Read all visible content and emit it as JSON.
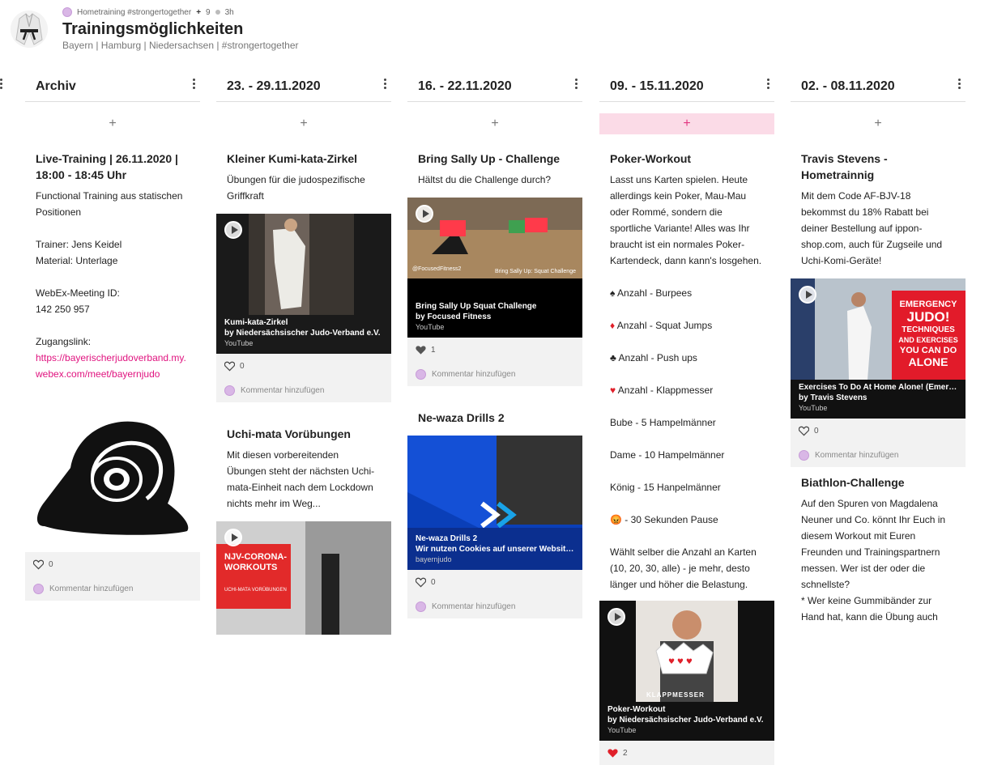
{
  "header": {
    "group": "Hometraining #strongertogether",
    "members": "9",
    "time": "3h",
    "title": "Trainingsmöglichkeiten",
    "subtitle": "Bayern | Hamburg | Niedersachsen | #strongertogether"
  },
  "common": {
    "comment_placeholder": "Kommentar hinzufügen",
    "add": "+"
  },
  "columns": [
    {
      "title": "Archiv",
      "posts": [
        {
          "title": "Live-Training | 26.11.2020 | 18:00 - 18:45 Uhr",
          "body": "Functional Training aus statischen Positionen\n\nTrainer: Jens Keidel\nMaterial: Unterlage\n\nWebEx-Meeting ID:\n142 250 957\n\nZugangslink:",
          "link": "https://bayerischerjudoverband.my.webex.com/meet/bayernjudo",
          "image": "webex-logo",
          "likes": "0"
        }
      ]
    },
    {
      "title": "23. - 29.11.2020",
      "posts": [
        {
          "title": "Kleiner Kumi-kata-Zirkel",
          "body": "Übungen für die judospezifische Griffkraft",
          "attachment": {
            "title": "Kumi-kata-Zirkel",
            "subtitle": "by Niedersächsischer Judo-Verband e.V.",
            "source": "YouTube"
          },
          "likes": "0"
        },
        {
          "title": "Uchi-mata Vorübungen",
          "body": "Mit diesen vorbereitenden Übungen steht der nächsten Uchi-mata-Einheit nach dem Lockdown nichts mehr im Weg...",
          "thumb_text": "NJV-CORONA-WORKOUTS",
          "thumb_sub": "UCHI-MATA VORÜBUNGEN"
        }
      ]
    },
    {
      "title": "16. - 22.11.2020",
      "posts": [
        {
          "title": "Bring Sally Up - Challenge",
          "body": "Hältst du die Challenge durch?",
          "thumb_tag": "@FocusedFitness2",
          "thumb_tag2": "Bring Sally Up: Squat Challenge",
          "attachment": {
            "title": "Bring Sally Up Squat Challenge",
            "subtitle": "by Focused Fitness",
            "source": "YouTube"
          },
          "likes": "1"
        },
        {
          "title": "Ne-waza Drills 2",
          "attachment": {
            "title": "Ne-waza Drills 2",
            "subtitle": "Wir nutzen Cookies auf unserer Website. ...",
            "source": "bayernjudo"
          },
          "likes": "0"
        }
      ]
    },
    {
      "title": "09. - 15.11.2020",
      "posts": [
        {
          "title": "Poker-Workout",
          "body": "Lasst uns Karten spielen. Heute allerdings kein Poker, Mau-Mau oder Rommé, sondern die sportliche Variante! Alles was Ihr braucht ist ein normales Poker-Kartendeck, dann kann's losgehen.",
          "list": [
            {
              "icon": "♠",
              "color": "#222",
              "text": " Anzahl - Burpees"
            },
            {
              "icon": "♦",
              "color": "#e0202a",
              "text": " Anzahl - Squat Jumps"
            },
            {
              "icon": "♣",
              "color": "#222",
              "text": " Anzahl - Push ups"
            },
            {
              "icon": "♥",
              "color": "#e0202a",
              "text": " Anzahl - Klappmesser"
            },
            {
              "icon": "",
              "color": "#222",
              "text": "Bube - 5 Hampelmänner"
            },
            {
              "icon": "",
              "color": "#222",
              "text": "Dame - 10 Hampelmänner"
            },
            {
              "icon": "",
              "color": "#222",
              "text": "König - 15 Hanpelmänner"
            },
            {
              "icon": "😡",
              "color": "#222",
              "text": " - 30 Sekunden Pause"
            }
          ],
          "body2": "Wählt selber die Anzahl an Karten (10, 20, 30, alle) - je mehr, desto länger und höher die Belastung.",
          "attachment": {
            "title": "Poker-Workout",
            "subtitle": "by Niedersächsischer Judo-Verband e.V.",
            "source": "YouTube"
          },
          "thumb_text": "KLAPPMESSER",
          "likes": "2"
        }
      ]
    },
    {
      "title": "02. - 08.11.2020",
      "posts": [
        {
          "title": "Travis Stevens - Hometrainnig",
          "body": "Mit dem Code AF-BJV-18 bekommst du 18% Rabatt bei deiner Bestellung auf ippon-shop.com, auch für Zugseile und Uchi-Komi-Geräte!",
          "thumb_lines": [
            "EMERGENCY",
            "JUDO!",
            "TECHNIQUES",
            "AND EXERCISES",
            "YOU CAN DO",
            "ALONE"
          ],
          "attachment": {
            "title": "Exercises To Do At Home Alone! (Emergency Judo)",
            "subtitle": "by Travis Stevens",
            "source": "YouTube"
          },
          "likes": "0"
        },
        {
          "title": "Biathlon-Challenge",
          "body": "Auf den Spuren von Magdalena Neuner und Co. könnt Ihr Euch in diesem Workout mit Euren Freunden und Trainingspartnern messen. Wer ist der oder die schnellste?\n* Wer keine Gummibänder zur Hand hat, kann die Übung auch"
        }
      ]
    }
  ],
  "colors": {
    "accent": "#e0137f",
    "highlight": "#fbdbe7",
    "heart_filled": "#e0202a"
  }
}
